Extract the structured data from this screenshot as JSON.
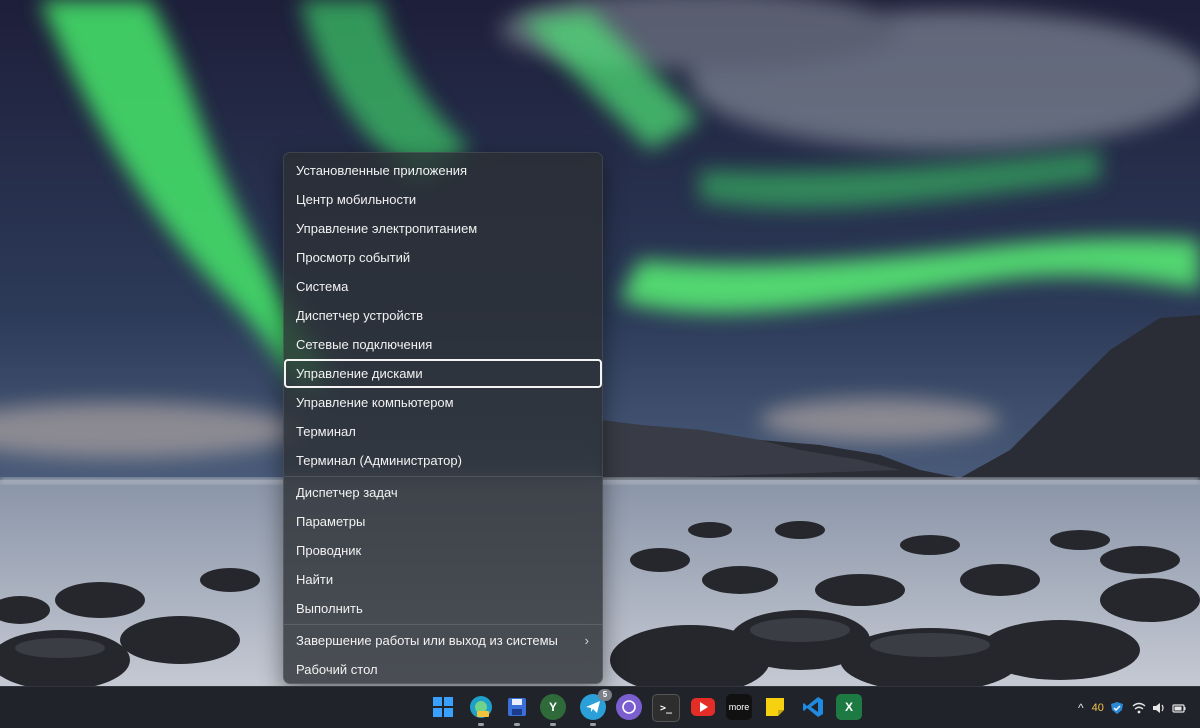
{
  "context_menu": {
    "items": [
      "Установленные приложения",
      "Центр мобильности",
      "Управление электропитанием",
      "Просмотр событий",
      "Система",
      "Диспетчер устройств",
      "Сетевые подключения",
      "Управление дисками",
      "Управление компьютером",
      "Терминал",
      "Терминал (Администратор)"
    ],
    "items_group2": [
      "Диспетчер задач",
      "Параметры",
      "Проводник",
      "Найти",
      "Выполнить"
    ],
    "shutdown_label": "Завершение работы или выход из системы",
    "desktop_label": "Рабочий стол",
    "focused_item": "Управление дисками",
    "submenu_chevron": "›"
  },
  "taskbar": {
    "apps": [
      {
        "name": "start",
        "icon": "windows-logo-icon",
        "color": "#3aa0ff"
      },
      {
        "name": "edge",
        "icon": "edge-icon",
        "color": "#1fa0c8",
        "small_label": "CAN"
      },
      {
        "name": "save",
        "icon": "floppy-icon",
        "color": "#3b6fd8"
      },
      {
        "name": "app-y",
        "icon": "leaf-icon",
        "color": "#2f6b3a",
        "label": "Y"
      },
      {
        "name": "telegram",
        "icon": "telegram-icon",
        "color": "#2a9fd8",
        "badge": "5"
      },
      {
        "name": "viber",
        "icon": "viber-icon",
        "color": "#7b5fd0"
      },
      {
        "name": "terminal",
        "icon": "terminal-icon",
        "color": "#2e2e2e",
        "label": ">_"
      },
      {
        "name": "youtube",
        "icon": "youtube-icon",
        "color": "#e52d27"
      },
      {
        "name": "more",
        "icon": "more-app-icon",
        "color": "#111111",
        "label": "more"
      },
      {
        "name": "sticky-notes",
        "icon": "sticky-notes-icon",
        "color": "#f5d10f"
      },
      {
        "name": "vscode",
        "icon": "vscode-icon",
        "color": "#1f8ae0"
      },
      {
        "name": "excel",
        "icon": "excel-icon",
        "color": "#1e7a43",
        "label": "X"
      }
    ],
    "tray": {
      "overflow_chevron": "^",
      "count": "40"
    }
  }
}
